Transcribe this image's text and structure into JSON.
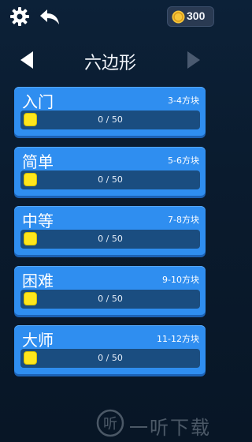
{
  "header": {
    "coins": "300",
    "settings_icon": "gear-icon",
    "back_icon": "back-arrow-icon"
  },
  "title_bar": {
    "title": "六边形",
    "prev_icon": "triangle-left-icon",
    "next_icon": "triangle-right-icon"
  },
  "levels": [
    {
      "name": "入门",
      "range": "3-4方块",
      "progress": "0 / 50",
      "fraction": 0
    },
    {
      "name": "简单",
      "range": "5-6方块",
      "progress": "0 / 50",
      "fraction": 0
    },
    {
      "name": "中等",
      "range": "7-8方块",
      "progress": "0 / 50",
      "fraction": 0
    },
    {
      "name": "困难",
      "range": "9-10方块",
      "progress": "0 / 50",
      "fraction": 0
    },
    {
      "name": "大师",
      "range": "11-12方块",
      "progress": "0 / 50",
      "fraction": 0
    }
  ],
  "watermark": {
    "text": "一听下载"
  },
  "colors": {
    "background": "#0b1d31",
    "card": "#2f8ef0",
    "progress_track": "#1a4d80",
    "progress_fill": "#ffe61c",
    "coin": "#f6c63a"
  }
}
